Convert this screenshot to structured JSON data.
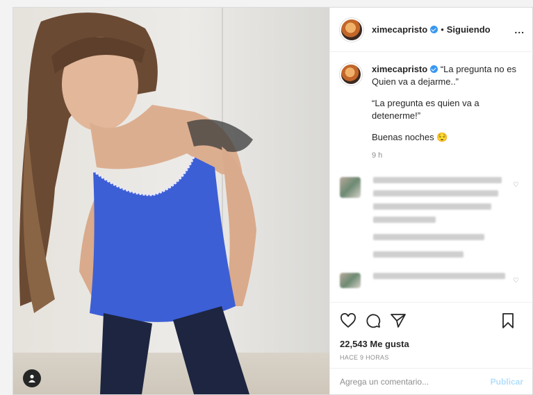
{
  "post": {
    "username": "ximecapristo",
    "separator": "•",
    "follow_status": "Siguiendo",
    "more_label": "...",
    "caption": {
      "username": "ximecapristo",
      "line1": "“La pregunta no es Quien va a dejarme..”",
      "line2": "“La pregunta es quien va a detenerme!”",
      "line3": "Buenas noches 😌",
      "time": "9 h"
    },
    "likes": "22,543 Me gusta",
    "time_ago": "HACE 9 HORAS",
    "comment_placeholder": "Agrega un comentario...",
    "publish_label": "Publicar"
  },
  "colors": {
    "verified": "#3897f0",
    "publish": "#b2dffc",
    "top": "#3c5fd6"
  }
}
